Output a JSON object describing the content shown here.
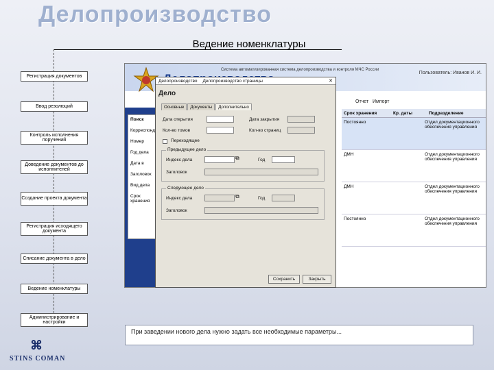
{
  "slide": {
    "title": "Делопроизводство",
    "subtitle": "Ведение номенклатуры",
    "description": "При заведении нового дела нужно задать все необходимые параметры...",
    "brand": "STINS COMAN"
  },
  "steps": [
    "Регистрация документов",
    "Ввод резолюций",
    "Контроль исполнения поручений",
    "Доведение документов до исполнителей",
    "Создание проекта документа",
    "Регистрация исходящего документа",
    "Списание документа в дело",
    "Ведение номенклатуры",
    "Администрирование и настройки"
  ],
  "background_app": {
    "system_title": "Система автоматизированная система делопроизводства и контроля МЧС России",
    "user_label": "Пользователь: Иванов И. И.",
    "app_title": "Делопроизводство",
    "toolbar": [
      "Отчет",
      "Импорт"
    ],
    "search_label": "Поиск",
    "search_fields": [
      "Корреспондент",
      "Номер",
      "Год дела",
      "Дата в",
      "Заголовок",
      "Вид дела",
      "Срок хранения"
    ],
    "table_headers": [
      "Срок хранения",
      "Кр. даты",
      "Подразделение"
    ],
    "rows": [
      {
        "term": "Постоянно",
        "unit": "Отдел документационного обеспечения управления"
      },
      {
        "term": "ДМН",
        "unit": "Отдел документационного обеспечения управления"
      },
      {
        "term": "ДМН",
        "unit": "Отдел документационного обеспечения управления"
      },
      {
        "term": "Постоянно",
        "unit": "Отдел документационного обеспечения управления"
      }
    ]
  },
  "dialog": {
    "tabs_bar": [
      "Делопроизводство",
      "Делопроизводство страницы"
    ],
    "heading": "Дело",
    "tabs": [
      "Основные",
      "Документы",
      "Дополнительно"
    ],
    "fields": {
      "open_date": "Дата открытия",
      "close_date": "Дата закрытия",
      "volumes": "Кол-во томов",
      "pages": "Кол-во страниц",
      "transitional": "Переходящее",
      "prev_case": "Предыдущее дело",
      "next_case": "Следующее дело",
      "case_index": "Индекс дела",
      "year": "Год",
      "heading_label": "Заголовок"
    },
    "buttons": {
      "save": "Сохранить",
      "cancel": "Закрыть"
    }
  },
  "colors": {
    "title": "#9fb0cf",
    "accent": "#1f3f8c"
  }
}
